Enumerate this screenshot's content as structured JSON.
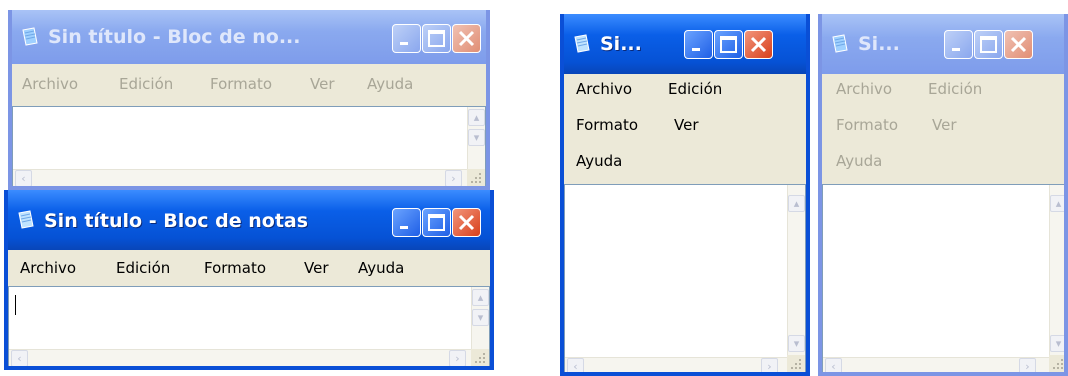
{
  "colors": {
    "active_title": "#0652d5",
    "inactive_title": "#7e9ceb",
    "menu_bg": "#ece9d8",
    "close_red": "#d8401c"
  },
  "icons": {
    "app": "notepad-icon",
    "minimize": "minimize-icon",
    "maximize": "maximize-icon",
    "close": "close-icon",
    "left": "scroll-left-arrow-icon",
    "right": "scroll-right-arrow-icon",
    "up": "scroll-up-arrow-icon",
    "down": "scroll-down-arrow-icon",
    "grip": "resize-grip-icon"
  },
  "win1": {
    "title": "Sin título - Bloc de no...",
    "menu": {
      "archivo": "Archivo",
      "edicion": "Edición",
      "formato": "Formato",
      "ver": "Ver",
      "ayuda": "Ayuda"
    }
  },
  "win2": {
    "title": "Sin título - Bloc de notas",
    "menu": {
      "archivo": "Archivo",
      "edicion": "Edición",
      "formato": "Formato",
      "ver": "Ver",
      "ayuda": "Ayuda"
    }
  },
  "win3": {
    "title": "Si...",
    "menu": {
      "archivo": "Archivo",
      "edicion": "Edición",
      "formato": "Formato",
      "ver": "Ver",
      "ayuda": "Ayuda"
    }
  },
  "win4": {
    "title": "Si...",
    "menu": {
      "archivo": "Archivo",
      "edicion": "Edición",
      "formato": "Formato",
      "ver": "Ver",
      "ayuda": "Ayuda"
    }
  }
}
